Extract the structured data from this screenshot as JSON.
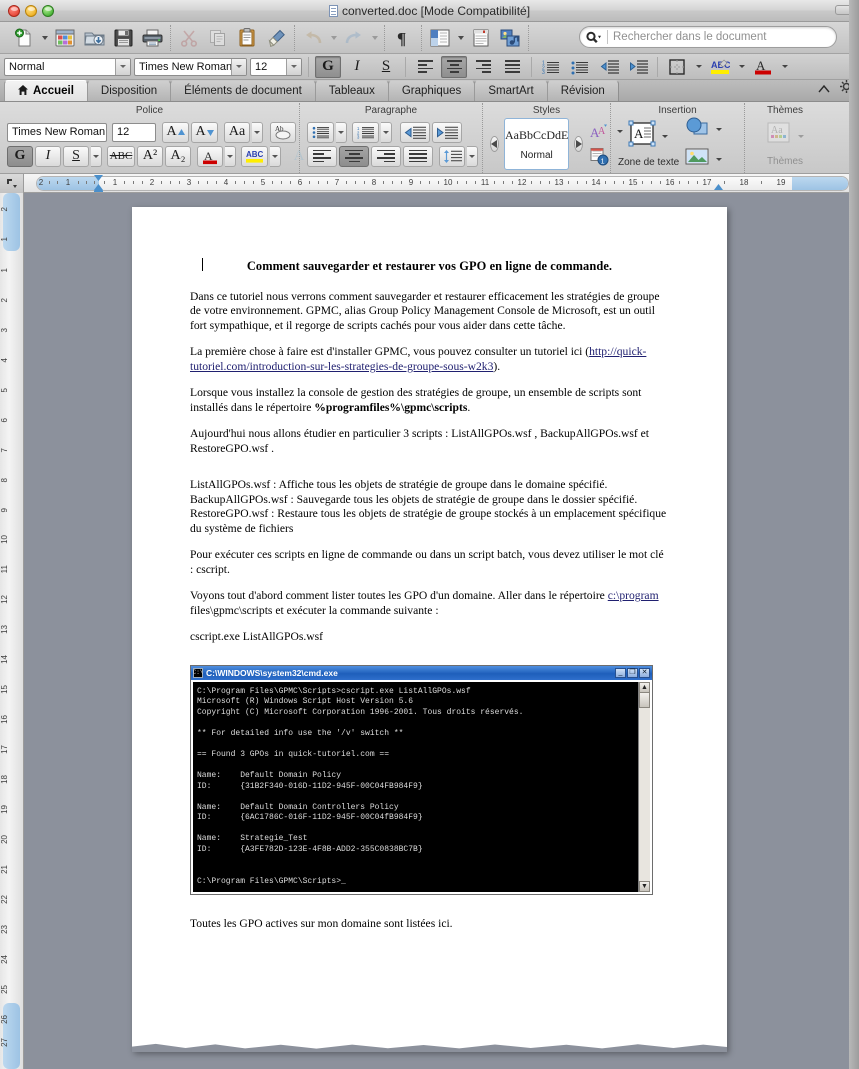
{
  "window": {
    "title": "converted.doc [Mode Compatibilité]",
    "traffic_lights": [
      "close",
      "minimize",
      "zoom"
    ],
    "title_icon": "document-icon"
  },
  "standard_toolbar": {
    "buttons": [
      {
        "name": "new-document",
        "icon": "new-doc-icon"
      },
      {
        "name": "new-from-template",
        "icon": "template-gallery-icon"
      },
      {
        "name": "open",
        "icon": "open-folder-icon"
      },
      {
        "name": "save",
        "icon": "floppy-disk-icon"
      },
      {
        "name": "print",
        "icon": "printer-icon"
      },
      {
        "name": "cut",
        "icon": "scissors-icon"
      },
      {
        "name": "copy",
        "icon": "copy-icon"
      },
      {
        "name": "paste",
        "icon": "clipboard-icon"
      },
      {
        "name": "format-painter",
        "icon": "paintbrush-icon"
      },
      {
        "name": "undo",
        "icon": "undo-arrow-icon"
      },
      {
        "name": "redo",
        "icon": "redo-arrow-icon"
      },
      {
        "name": "show-formatting-marks",
        "icon": "pilcrow-icon"
      },
      {
        "name": "sidebar",
        "icon": "sidebar-panel-icon"
      },
      {
        "name": "notebook-view",
        "icon": "notebook-icon"
      },
      {
        "name": "media-browser",
        "icon": "media-browser-icon"
      }
    ],
    "search": {
      "placeholder": "Rechercher dans le document",
      "value": "",
      "icon": "search-magnifier-icon"
    }
  },
  "formatting_toolbar": {
    "style": {
      "value": "Normal",
      "label": "style-combo"
    },
    "font": {
      "value": "Times New Roman"
    },
    "size": {
      "value": "12"
    },
    "bold": {
      "label": "G",
      "active": true
    },
    "italic": {
      "label": "I",
      "active": false
    },
    "underline": {
      "label": "S",
      "active": false
    },
    "align": [
      "align-left",
      "align-center",
      "align-right",
      "align-justify"
    ],
    "align_active": "align-center",
    "numbered_list": "numbered-list-icon",
    "bulleted_list": "bulleted-list-icon",
    "decrease_indent": "decrease-indent-icon",
    "increase_indent": "increase-indent-icon",
    "borders": "borders-icon",
    "highlight": {
      "icon": "highlight-abc-icon",
      "color": "#ffee00"
    },
    "font_color": {
      "icon": "font-color-a-icon",
      "color": "#cc0000"
    }
  },
  "ribbon_tabs": [
    {
      "id": "accueil",
      "label": "Accueil",
      "active": true,
      "icon": "home-icon"
    },
    {
      "id": "disposition",
      "label": "Disposition",
      "active": false
    },
    {
      "id": "elements",
      "label": "Éléments de document",
      "active": false
    },
    {
      "id": "tableaux",
      "label": "Tableaux",
      "active": false
    },
    {
      "id": "graphiques",
      "label": "Graphiques",
      "active": false
    },
    {
      "id": "smartart",
      "label": "SmartArt",
      "active": false
    },
    {
      "id": "revision",
      "label": "Révision",
      "active": false
    }
  ],
  "ribbon_tabs_right": {
    "collapse": "chevron-up-icon",
    "settings": "gear-icon"
  },
  "ribbon": {
    "groups": [
      {
        "id": "police",
        "title": "Police",
        "font_name": "Times New Roman",
        "font_size": "12",
        "grow_font": "A",
        "shrink_font": "A",
        "change_case": "Aa",
        "clear_formatting": "Ab",
        "bold": "G",
        "italic": "I",
        "underline": "S",
        "strikethrough": "ABC",
        "superscript": "A²",
        "subscript": "A₂",
        "font_color": "A",
        "highlight": "ABC",
        "text_effects": "A"
      },
      {
        "id": "paragraphe",
        "title": "Paragraphe",
        "bullets": "bulleted-list-icon",
        "numbering": "numbered-list-icon",
        "decrease_indent": "decrease-indent-icon",
        "increase_indent": "increase-indent-icon",
        "align_left": "align-left-icon",
        "align_center": "align-center-icon",
        "align_right": "align-right-icon",
        "justify": "justify-icon",
        "line_spacing": "line-spacing-icon"
      },
      {
        "id": "styles",
        "title": "Styles",
        "preview_sample": "AaBbCcDdE",
        "preview_name": "Normal",
        "prev": "previous-style-arrow",
        "next": "next-style-arrow",
        "styles_pane": "styles-pane-icon",
        "list_styles": "list-styles-icon"
      },
      {
        "id": "insertion",
        "title": "Insertion",
        "text_box_label": "Zone de texte",
        "text_box_icon": "text-box-icon",
        "shapes_icon": "shapes-icon",
        "picture_icon": "picture-icon"
      },
      {
        "id": "themes",
        "title": "Thèmes",
        "themes_label": "Thèmes",
        "themes_icon": "themes-aa-icon"
      }
    ]
  },
  "ruler": {
    "horizontal_numbers": [
      "2",
      "1",
      "1",
      "2",
      "3",
      "4",
      "5",
      "6",
      "7",
      "8",
      "9",
      "10",
      "11",
      "12",
      "13",
      "14",
      "15",
      "16",
      "17",
      "18",
      "19"
    ],
    "vertical_numbers": [
      "2",
      "1",
      "1",
      "2",
      "3",
      "4",
      "5",
      "6",
      "7",
      "8",
      "9",
      "10",
      "11",
      "12",
      "13",
      "14",
      "15",
      "16",
      "17",
      "18",
      "19",
      "20",
      "21",
      "22",
      "23",
      "24",
      "25",
      "26",
      "27"
    ],
    "corner_icon": "tab-stop-icon",
    "left_indent_marker": "indent-marker",
    "right_indent_marker": "indent-marker"
  },
  "document": {
    "heading": "Comment sauvegarder et restaurer vos GPO en ligne de commande.",
    "paragraphs": [
      "Dans ce tutoriel nous verrons comment sauvegarder et restaurer efficacement les stratégies de groupe de votre environnement. GPMC, alias Group Policy Management Console de Microsoft, est un outil fort sympathique, et il regorge de scripts cachés pour vous aider dans cette tâche."
    ],
    "para2_pre": "La première chose à faire est d'installer GPMC, vous pouvez consulter un tutoriel ici (",
    "para2_link": "http://quick-tutoriel.com/introduction-sur-les-strategies-de-groupe-sous-w2k3",
    "para2_post": ").",
    "para3_pre": "Lorsque vous installez la console de gestion des stratégies de groupe, un ensemble de scripts sont installés dans le répertoire ",
    "para3_bold": "%programfiles%\\gpmc\\scripts",
    "para3_post": ".",
    "para4": "Aujourd'hui nous allons étudier en particulier 3 scripts : ListAllGPOs.wsf , BackupAllGPOs.wsf et RestoreGPO.wsf .",
    "para5_line1": "ListAllGPOs.wsf : Affiche tous les objets de stratégie de groupe dans le domaine spécifié.",
    "para5_line2": "BackupAllGPOs.wsf  : Sauvegarde tous les objets de stratégie de groupe dans le dossier spécifié.",
    "para5_line3": "RestoreGPO.wsf  : Restaure tous les objets de stratégie de groupe stockés à un emplacement spécifique du système de fichiers",
    "para6": "Pour exécuter ces scripts en ligne de commande ou dans un script batch, vous devez utiliser le mot clé : cscript.",
    "para7_pre": "Voyons tout d'abord comment lister toutes les GPO d'un domaine. Aller dans le répertoire ",
    "para7_link": "c:\\program",
    "para7_post": " files\\gpmc\\scripts et exécuter la commande suivante :",
    "para8": "cscript.exe ListAllGPOs.wsf",
    "para9": "Toutes les GPO actives sur mon domaine sont listées ici."
  },
  "cmd_window": {
    "title": "C:\\WINDOWS\\system32\\cmd.exe",
    "title_icon": "cmd-console-icon",
    "buttons": [
      {
        "name": "minimize-button",
        "glyph": "_"
      },
      {
        "name": "maximize-button",
        "glyph": "❐"
      },
      {
        "name": "close-button",
        "glyph": "✕"
      }
    ],
    "scrollbar": {
      "up": "▲",
      "down": "▼"
    },
    "console_text": "C:\\Program Files\\GPMC\\Scripts>cscript.exe ListAllGPOs.wsf\nMicrosoft (R) Windows Script Host Version 5.6\nCopyright (C) Microsoft Corporation 1996-2001. Tous droits réservés.\n\n** For detailed info use the '/v' switch **\n\n== Found 3 GPOs in quick-tutoriel.com ==\n\nName:    Default Domain Policy\nID:      {31B2F340-016D-11D2-945F-00C04FB984F9}\n\nName:    Default Domain Controllers Policy\nID:      {6AC1786C-016F-11D2-945F-00C04fB984F9}\n\nName:    Strategie_Test\nID:      {A3FE782D-123E-4F8B-ADD2-355C0838BC7B}\n\n\nC:\\Program Files\\GPMC\\Scripts>_"
  },
  "colors": {
    "window_bg": "#8c919c",
    "page_bg": "#ffffff",
    "accent_blue": "#4a8fcb",
    "titlebar_blue": "#1e5fbb",
    "link": "#202070"
  }
}
